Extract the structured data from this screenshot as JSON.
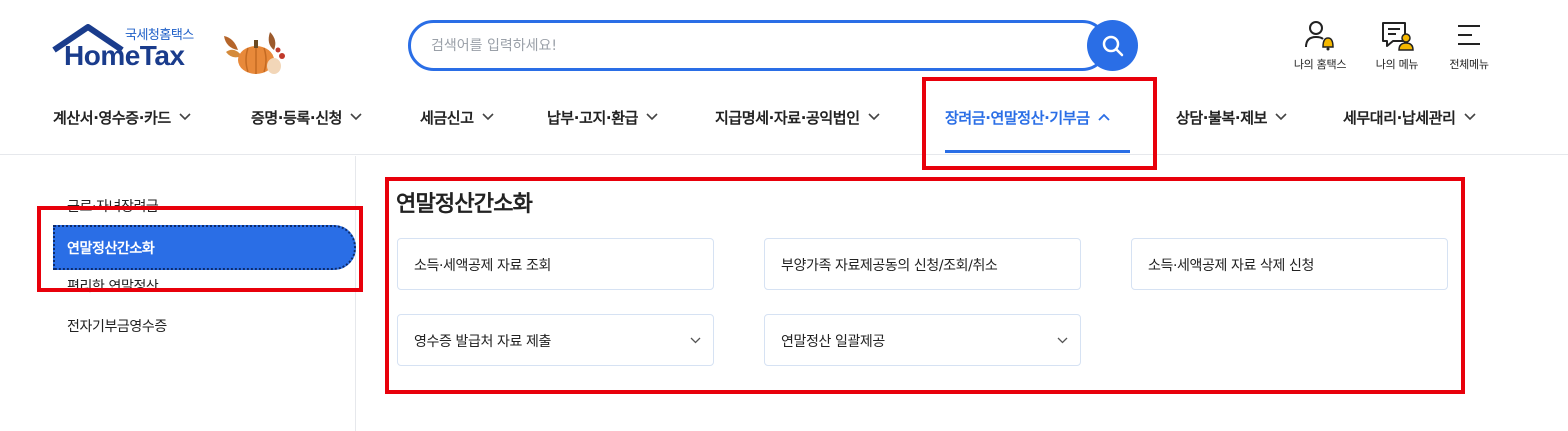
{
  "header": {
    "logo": {
      "sub": "국세청홈택스",
      "main": "HomeTax"
    },
    "search": {
      "placeholder": "검색어를 입력하세요!",
      "button_icon": "search-icon"
    },
    "utils": [
      {
        "label": "나의 홈택스",
        "icon": "user-bell-icon"
      },
      {
        "label": "나의 메뉴",
        "icon": "user-list-icon"
      },
      {
        "label": "전체메뉴",
        "icon": "hamburger-icon"
      }
    ]
  },
  "gnb": {
    "items": [
      {
        "label": "계산서·영수증·카드",
        "expanded": false
      },
      {
        "label": "증명·등록·신청",
        "expanded": false
      },
      {
        "label": "세금신고",
        "expanded": false
      },
      {
        "label": "납부·고지·환급",
        "expanded": false
      },
      {
        "label": "지급명세·자료·공익법인",
        "expanded": false
      },
      {
        "label": "장려금·연말정산·기부금",
        "expanded": true
      },
      {
        "label": "상담·불복·제보",
        "expanded": false
      },
      {
        "label": "세무대리·납세관리",
        "expanded": false
      }
    ]
  },
  "sidebar": {
    "items": [
      {
        "label": "근로·자녀장려금"
      },
      {
        "label": "연말정산간소화",
        "active": true
      },
      {
        "label": "편리한 연말정산"
      },
      {
        "label": "전자기부금영수증"
      }
    ]
  },
  "main": {
    "title": "연말정산간소화",
    "cards": [
      {
        "label": "소득·세액공제 자료 조회",
        "has_dropdown": false
      },
      {
        "label": "부양가족 자료제공동의 신청/조회/취소",
        "has_dropdown": false
      },
      {
        "label": "소득·세액공제 자료 삭제 신청",
        "has_dropdown": false
      },
      {
        "label": "영수증 발급처 자료 제출",
        "has_dropdown": true
      },
      {
        "label": "연말정산 일괄제공",
        "has_dropdown": true
      }
    ]
  },
  "colors": {
    "accent": "#2a6ee6",
    "highlight": "#e8000b",
    "logo_navy": "#1a3c8c"
  }
}
